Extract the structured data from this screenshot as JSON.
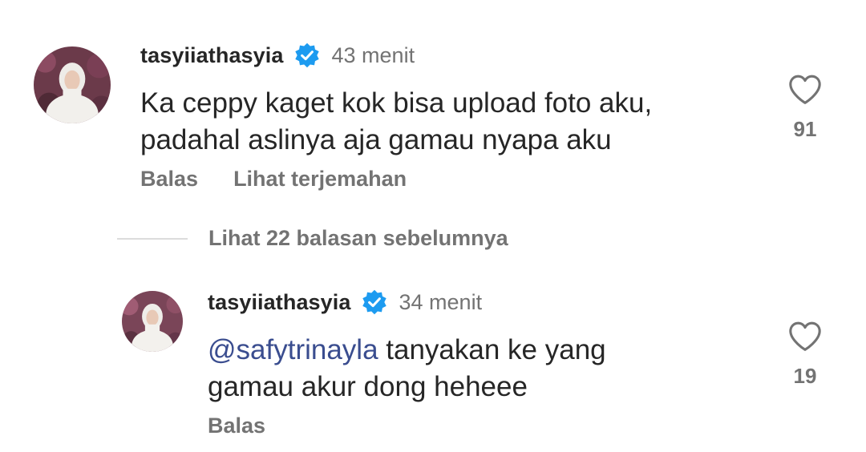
{
  "comments": [
    {
      "username": "tasyiiathasyia",
      "timestamp": "43 menit",
      "text_lines": [
        "Ka ceppy kaget kok bisa upload foto aku,",
        "padahal aslinya aja gamau nyapa aku"
      ],
      "likes": "91",
      "reply_label": "Balas",
      "translate_label": "Lihat terjemahan"
    },
    {
      "username": "tasyiiathasyia",
      "timestamp": "34 menit",
      "mention": "@safytrinayla",
      "text_line1_rest": " tanyakan ke yang",
      "text_line2": "gamau akur dong heheee",
      "likes": "19",
      "reply_label": "Balas"
    }
  ],
  "view_replies_label": "Lihat 22 balasan sebelumnya",
  "colors": {
    "verified": "#1d9bf0",
    "mention": "#3a4d8f",
    "secondary_text": "#737373",
    "primary_text": "#262626"
  },
  "icons": [
    "verified-badge-icon",
    "heart-outline-icon",
    "threads-icon"
  ]
}
